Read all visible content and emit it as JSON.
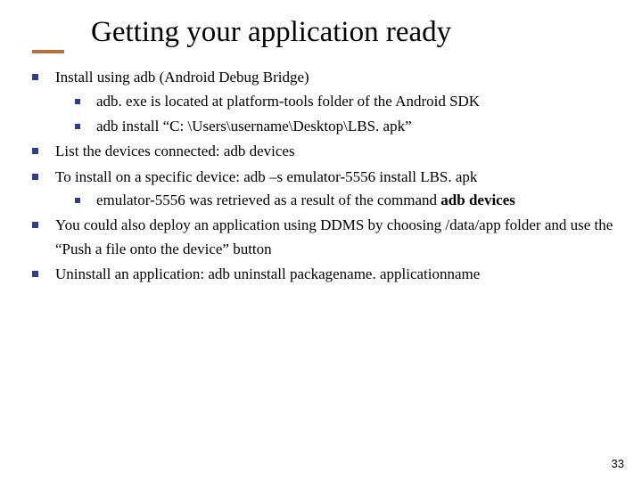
{
  "title": "Getting your application ready",
  "bullets": {
    "b1": "Install using adb (Android Debug Bridge)",
    "b1a": "adb. exe is located at platform-tools folder of the Android SDK",
    "b1b": "adb install “C: \\Users\\username\\Desktop\\LBS. apk”",
    "b2": "List the devices connected: adb devices",
    "b3_pre": "To install on a specific device: adb –s emulator-5556 install LBS. apk",
    "b3a_pre": "emulator-5556 was retrieved as a result of the command ",
    "b3a_bold": "adb devices",
    "b4": "You could also deploy an application using DDMS by choosing /data/app folder and use the “Push a file onto the device” button",
    "b5": "Uninstall an application: adb uninstall packagename. applicationname"
  },
  "page_number": "33"
}
